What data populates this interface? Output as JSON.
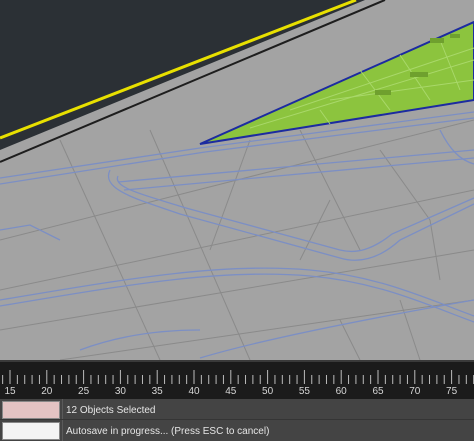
{
  "viewport": {
    "name": "3d-viewport",
    "colors": {
      "background": "#2b3035",
      "ground": "#a3a3a3",
      "lines": "#8090b8",
      "selected_area": "#8cc43e",
      "selection_edge": "#1c2ba0",
      "boundary": "#e8e000"
    }
  },
  "timeline": {
    "labels": [
      "15",
      "20",
      "25",
      "30",
      "35",
      "40",
      "45",
      "50",
      "55",
      "60",
      "65",
      "70",
      "75"
    ]
  },
  "status": {
    "selection_text": "12 Objects Selected",
    "prompt_text": "Autosave in progress... (Press ESC to cancel)"
  }
}
